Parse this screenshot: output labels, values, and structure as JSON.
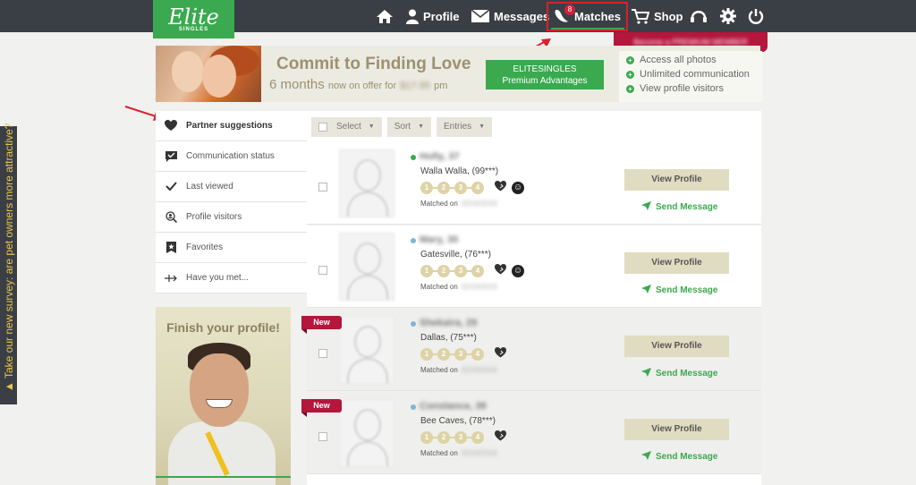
{
  "logo": {
    "brand": "Elite",
    "sub": "SINGLES"
  },
  "nav": {
    "home": "",
    "profile": "Profile",
    "messages": "Messages",
    "matches": "Matches",
    "matches_badge": "8",
    "shop": "Shop"
  },
  "premium_tab": "Become a PREMIUM MEMBER",
  "banner": {
    "title": "Commit to Finding Love",
    "sub_period": "6 months",
    "sub_mid": "now on offer for",
    "sub_price": "$17.95",
    "sub_unit": "pm",
    "button_line1": "ELITESINGLES",
    "button_line2": "Premium Advantages",
    "benefits": [
      "Access all photos",
      "Unlimited communication",
      "View profile visitors"
    ]
  },
  "sidebar": {
    "items": [
      {
        "label": "Partner suggestions",
        "icon": "heart-icon"
      },
      {
        "label": "Communication status",
        "icon": "message-check-icon"
      },
      {
        "label": "Last viewed",
        "icon": "checkmark-icon"
      },
      {
        "label": "Profile visitors",
        "icon": "visitor-search-icon"
      },
      {
        "label": "Favorites",
        "icon": "star-bookmark-icon"
      },
      {
        "label": "Have you met...",
        "icon": "arrow-cross-icon"
      }
    ]
  },
  "finish_profile": {
    "title": "Finish your profile!"
  },
  "toolbar": {
    "select": "Select",
    "sort": "Sort",
    "entries": "Entries"
  },
  "matches": [
    {
      "name": "Holly,",
      "age": "37",
      "city": "Walla Walla, (99***)",
      "matched_label": "Matched on",
      "date": "02/16/2016",
      "steps": [
        "1",
        "2",
        "3",
        "4"
      ],
      "new": false,
      "status_color": "#3aa94f",
      "smile": true
    },
    {
      "name": "Mary,",
      "age": "30",
      "city": "Gatesville, (76***)",
      "matched_label": "Matched on",
      "date": "02/16/2016",
      "steps": [
        "1",
        "2",
        "3",
        "4"
      ],
      "new": false,
      "status_color": "#7fb6d6",
      "smile": true
    },
    {
      "name": "Shekaira,",
      "age": "29",
      "city": "Dallas, (75***)",
      "matched_label": "Matched on",
      "date": "02/16/2016",
      "steps": [
        "1",
        "2",
        "3",
        "4"
      ],
      "new": true,
      "status_color": "#7fb6d6",
      "smile": false
    },
    {
      "name": "Constance,",
      "age": "38",
      "city": "Bee Caves, (78***)",
      "matched_label": "Matched on",
      "date": "02/16/2016",
      "steps": [
        "1",
        "2",
        "3",
        "4"
      ],
      "new": true,
      "status_color": "#7fb6d6",
      "smile": false
    }
  ],
  "card_labels": {
    "view_profile": "View Profile",
    "send_message": "Send Message",
    "new": "New"
  },
  "survey": "▲ Take our new survey: are pet owners more attractive?",
  "colors": {
    "brand_green": "#3aa94f",
    "nav_bg": "#3a3f46",
    "accent_red": "#b4163c",
    "highlight": "#d8202b"
  }
}
